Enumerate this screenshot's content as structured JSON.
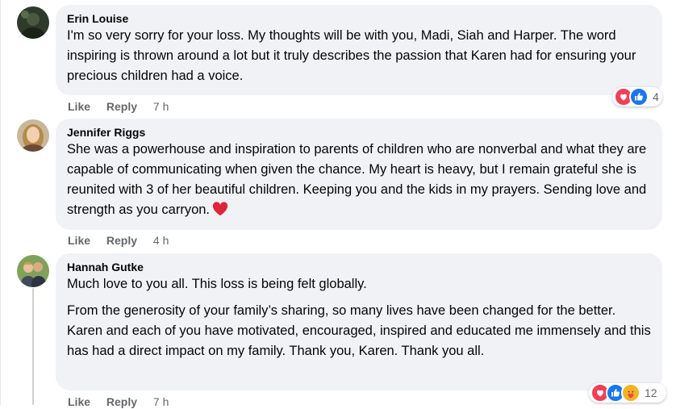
{
  "comments": [
    {
      "author": "Erin Louise",
      "paragraphs": [
        "I'm so very sorry for your loss. My thoughts will be with you, Madi, Siah and Harper. The word inspiring is thrown around a lot but it truly describes the passion that Karen had for ensuring your precious children had a voice."
      ],
      "actions": {
        "like": "Like",
        "reply": "Reply",
        "time": "7 h"
      },
      "reactions": {
        "icons": [
          "love-icon",
          "like-icon"
        ],
        "count": "4"
      }
    },
    {
      "author": "Jennifer Riggs",
      "paragraphs": [
        "She was a powerhouse and inspiration to parents of children who are nonverbal and what they are capable of communicating when given the chance. My heart is heavy, but I remain grateful she is reunited with 3 of her beautiful children. Keeping you and the kids in my prayers. Sending love and strength as you carryon."
      ],
      "trailing_emoji": "red-heart-emoji",
      "actions": {
        "like": "Like",
        "reply": "Reply",
        "time": "4 h"
      }
    },
    {
      "author": "Hannah Gutke",
      "paragraphs": [
        "Much love to you all. This loss is being felt globally.",
        "From the generosity of your family’s sharing, so many lives have been changed for the better. Karen and each of you have motivated, encouraged, inspired and educated me immensely and this has had a direct impact on my family. Thank you, Karen. Thank you all."
      ],
      "actions": {
        "like": "Like",
        "reply": "Reply",
        "time": "7 h"
      },
      "reactions": {
        "icons": [
          "love-icon",
          "like-icon",
          "care-icon"
        ],
        "count": "12"
      }
    }
  ],
  "colors": {
    "bubble": "#f0f2f5",
    "secondary_text": "#65676b",
    "love": "#f33e58",
    "like": "#1877f2",
    "care": "#f7b125"
  }
}
